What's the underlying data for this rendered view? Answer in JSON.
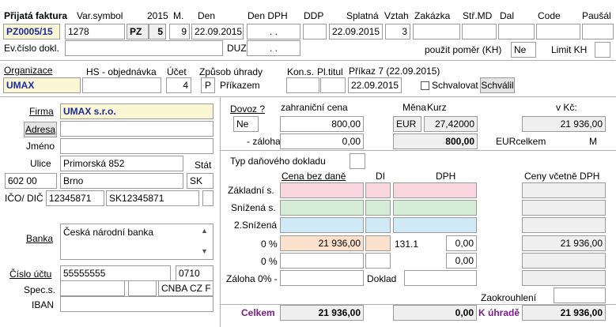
{
  "header": {
    "title": "Přijatá faktura",
    "labels": {
      "var_symbol": "Var.symbol",
      "year": "2015",
      "month": "M.",
      "den": "Den",
      "den_dph": "Den DPH",
      "ddp": "DDP",
      "splatna": "Splatná",
      "vztah": "Vztah",
      "zakazka": "Zakázka",
      "str_md": "Stř.MD",
      "dal": "Dal",
      "code": "Code",
      "pausal": "Paušál"
    },
    "values": {
      "invoice_no": "PZ0005/15",
      "var_symbol": "1278",
      "type": "PZ",
      "type_num": "5",
      "month": "9",
      "den": "22.09.2015",
      "den_dph": ". .",
      "splatna": "22.09.2015",
      "vztah": "3"
    },
    "evcislo_label": "Ev.číslo dokl.",
    "duzp_label": "DUZP",
    "duzp_value": ". .",
    "pouzit_pomer_label": "použit poměr (KH)",
    "pouzit_pomer_value": "Ne",
    "limit_kh_label": "Limit KH"
  },
  "org": {
    "organizace_label": "Organizace",
    "organizace_value": "UMAX",
    "hs_label": "HS - objednávka",
    "ucet_label": "Účet",
    "ucet_value": "4",
    "zpusob_label": "Způsob úhrady",
    "zpusob_code": "P",
    "zpusob_text": "Příkazem",
    "kons_label": "Kon.s.",
    "pltitul_label": "Pl.titul",
    "prikaz_label": "Příkaz 7 (22.09.2015)",
    "prikaz_date": "22.09.2015",
    "schvalovat_label": "Schvalovat",
    "schvalil_label": "Schválil"
  },
  "firm": {
    "firma_label": "Firma",
    "firma_value": "UMAX s.r.o.",
    "adresa_button": "Adresa",
    "jmeno_label": "Jméno",
    "ulice_label": "Ulice",
    "ulice_value": "Primorská 852",
    "stat_label": "Stát",
    "psc_value": "602 00",
    "mesto_value": "Brno",
    "stat_value": "SK",
    "ico_label": "IČO/ DIČ",
    "ico_value": "12345871",
    "dic_value": "SK12345871",
    "banka_label": "Banka",
    "banka_value": "Česká národní banka",
    "cislo_uctu_label": "Číslo účtu",
    "cislo_uctu_value": "55555555",
    "kod_banky": "0710",
    "spec_label": "Spec.s.",
    "swift_value": "CNBA CZ F",
    "iban_label": "IBAN"
  },
  "currency": {
    "dovoz_label": "Dovoz ?",
    "dovoz_value": "Ne",
    "zahranicni_label": "zahraniční cena",
    "zahranicni_value": "800,00",
    "mena_label": "Měna",
    "mena_value": "EUR",
    "kurz_label": "Kurz",
    "kurz_value": "27,42000",
    "vkc_label": "v Kč:",
    "vkc_value": "21 936,00",
    "zaloha_label": "- záloha",
    "zaloha_value": "0,00",
    "total_foreign": "800,00",
    "eurcelkem_label": "EURcelkem",
    "m_label": "M"
  },
  "vat": {
    "typ_label": "Typ daňového dokladu",
    "cena_bez_dane_label": "Cena bez daně",
    "di_label": "DI",
    "dph_label": "DPH",
    "ceny_vcetne_label": "Ceny včetně DPH",
    "zakladni_label": "Základní s.",
    "snizena_label": "Snížená s.",
    "snizena2_label": "2.Snížená",
    "zero1_label": "0 %",
    "zero1_value": "21 936,00",
    "zero1_code": "131.1",
    "zero1_dph": "0,00",
    "zero1_total": "21 936,00",
    "zero2_label": "0 %",
    "zero2_dph": "0,00",
    "zaloha0_label": "Záloha 0% -",
    "doklad_label": "Doklad",
    "zaokrouhleni_label": "Zaokrouhlení",
    "celkem_label": "Celkem",
    "celkem_value": "21 936,00",
    "celkem_dph": "0,00",
    "k_uhrade_label": "K úhradě",
    "k_uhrade_value": "21 936,00"
  }
}
